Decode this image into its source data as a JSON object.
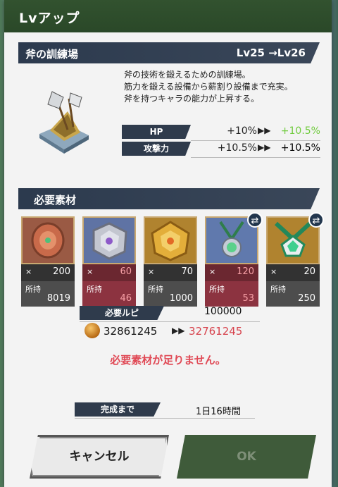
{
  "dialog": {
    "title": "Lvアップ"
  },
  "facility": {
    "name": "斧の訓練場",
    "level_from": "Lv25",
    "level_to": "→Lv26",
    "description": [
      "斧の技術を鍛えるための訓練場。",
      "筋力を鍛える設備から薪割り設備まで充実。",
      "斧を持つキャラの能力が上昇する。"
    ],
    "icon": "axe-training-ground-icon"
  },
  "stats": [
    {
      "label": "HP",
      "current": "+10%",
      "next": "+10.5%",
      "next_color": "#6fcb3c"
    },
    {
      "label": "攻撃力",
      "current": "+10.5%",
      "next": "+10.5%",
      "next_color": "#222222"
    }
  ],
  "materials_section": {
    "title": "必要素材"
  },
  "materials": [
    {
      "icon": "bronze-medal-icon",
      "required": "200",
      "owned_label": "所持",
      "owned": "8019",
      "sufficient": true,
      "swap": false
    },
    {
      "icon": "silver-medal-icon",
      "required": "60",
      "owned_label": "所持",
      "owned": "46",
      "sufficient": false,
      "swap": false
    },
    {
      "icon": "gold-medal-icon",
      "required": "70",
      "owned_label": "所持",
      "owned": "1000",
      "sufficient": true,
      "swap": false
    },
    {
      "icon": "green-pendant-icon",
      "required": "120",
      "owned_label": "所持",
      "owned": "53",
      "sufficient": false,
      "swap": true
    },
    {
      "icon": "emerald-necklace-icon",
      "required": "20",
      "owned_label": "所持",
      "owned": "250",
      "sufficient": true,
      "swap": true
    }
  ],
  "ruby": {
    "label": "必要ルピ",
    "required": "100000",
    "current": "32861245",
    "after": "32761245"
  },
  "warning": "必要素材が足りません。",
  "completion": {
    "label": "完成まで",
    "value": "1日16時間"
  },
  "buttons": {
    "cancel": "キャンセル",
    "ok": "OK"
  },
  "colors": {
    "header": "#2f4f2c",
    "label_bg": "#2f3b4c",
    "shortage": "#e04955",
    "increase": "#6fcb3c"
  }
}
